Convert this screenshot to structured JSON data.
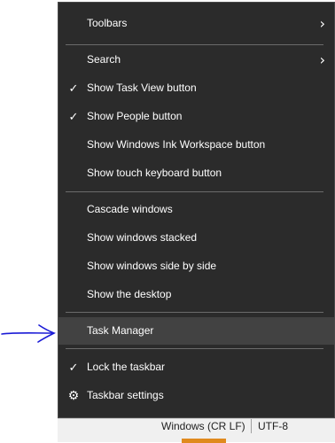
{
  "context_menu": {
    "items": [
      {
        "label": "Toolbars",
        "submenu": true
      },
      {
        "label": "Search",
        "submenu": true
      },
      {
        "label": "Show Task View button",
        "checked": true
      },
      {
        "label": "Show People button",
        "checked": true
      },
      {
        "label": "Show Windows Ink Workspace button"
      },
      {
        "label": "Show touch keyboard button"
      },
      {
        "label": "Cascade windows"
      },
      {
        "label": "Show windows stacked"
      },
      {
        "label": "Show windows side by side"
      },
      {
        "label": "Show the desktop"
      },
      {
        "label": "Task Manager",
        "highlighted": true
      },
      {
        "label": "Lock the taskbar",
        "checked": true
      },
      {
        "label": "Taskbar settings",
        "icon": "gear-icon"
      }
    ]
  },
  "status_bar": {
    "line_ending": "Windows (CR LF)",
    "encoding": "UTF-8"
  },
  "colors": {
    "menu_bg": "#2b2b2b",
    "hover_bg": "#424242",
    "annotation_arrow": "#1a1ad6"
  }
}
